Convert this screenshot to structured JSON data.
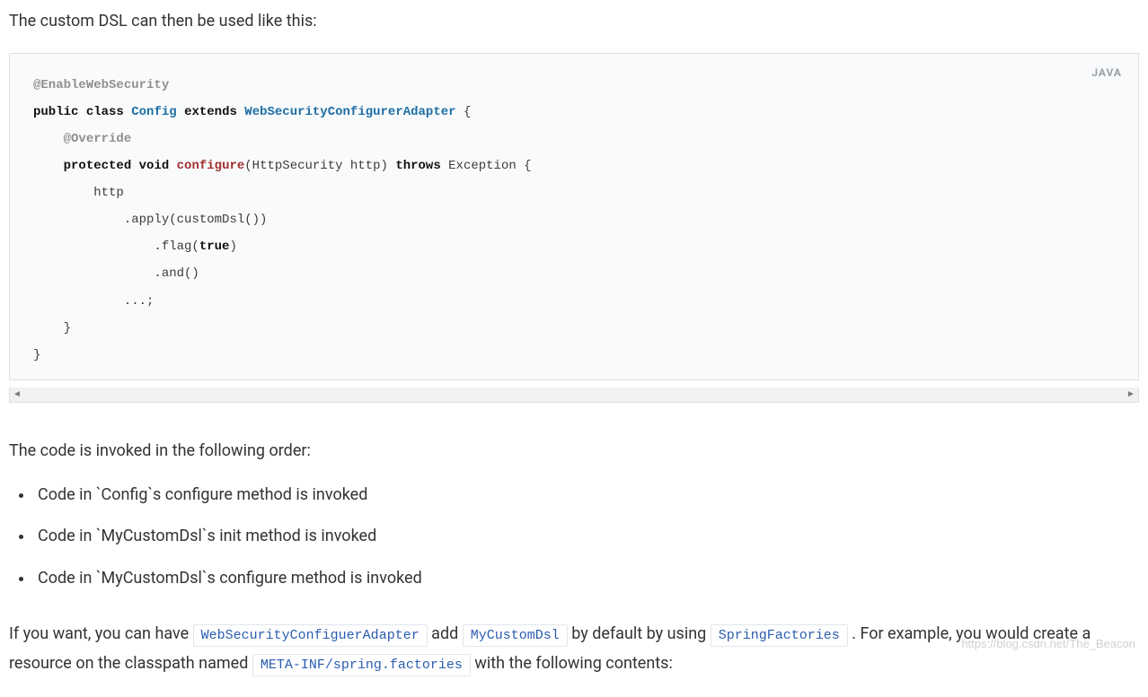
{
  "intro": "The custom DSL can then be used like this:",
  "code": {
    "lang_badge": "JAVA",
    "tokens": {
      "annotation_enable": "@EnableWebSecurity",
      "kw_public": "public",
      "kw_class": "class",
      "cls_config": "Config",
      "kw_extends": "extends",
      "cls_wsca": "WebSecurityConfigurerAdapter",
      "brace_open": " {",
      "annotation_override": "@Override",
      "kw_protected": "protected",
      "kw_void": "void",
      "method_configure": "configure",
      "sig_args_open": "(HttpSecurity http) ",
      "kw_throws": "throws",
      "sig_throws": " Exception {",
      "l_http": "http",
      "l_apply": ".apply(customDsl())",
      "l_flag_pre": ".flag(",
      "true": "true",
      "l_flag_post": ")",
      "l_and": ".and()",
      "l_ellipsis": "...;",
      "brace_close_inner": "}",
      "brace_close_outer": "}"
    }
  },
  "after": "The code is invoked in the following order:",
  "order_list": [
    "Code in `Config`s configure method is invoked",
    "Code in `MyCustomDsl`s init method is invoked",
    "Code in `MyCustomDsl`s configure method is invoked"
  ],
  "final_para": {
    "t1": "If you want, you can have ",
    "c1": "WebSecurityConfiguerAdapter",
    "t2": " add ",
    "c2": "MyCustomDsl",
    "t3": " by default by using ",
    "c3": "SpringFactories",
    "t4": ". For example, you would create a resource on the classpath named ",
    "c4": "META-INF/spring.factories",
    "t5": " with the following contents:"
  },
  "watermark": "https://blog.csdn.net/The_Beacon"
}
